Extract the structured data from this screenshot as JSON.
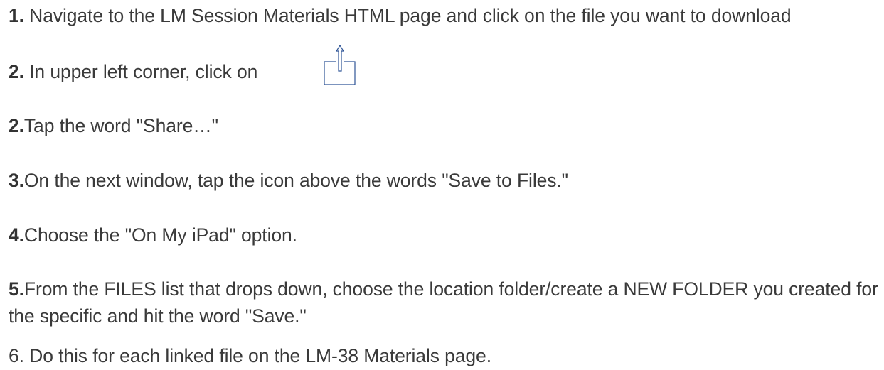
{
  "steps": [
    {
      "num": "1.",
      "text": " Navigate to the LM Session Materials HTML page and click on the file you want to download"
    },
    {
      "num": "2.",
      "text": " In upper left corner, click on"
    },
    {
      "num": "2.",
      "text": "Tap the word \"Share…\""
    },
    {
      "num": "3.",
      "text": "On the next window, tap the icon above the words \"Save to Files.\""
    },
    {
      "num": "4.",
      "text": "Choose the \"On My iPad\" option."
    },
    {
      "num": "5.",
      "text": "From the FILES list that drops down, choose the location folder/create a NEW FOLDER you created for the specific and hit the word \"Save.\""
    },
    {
      "num": "",
      "text": "6. Do this for each linked file on the LM-38 Materials page."
    }
  ],
  "icons": {
    "share": "share-icon",
    "color": "#2f5597"
  }
}
